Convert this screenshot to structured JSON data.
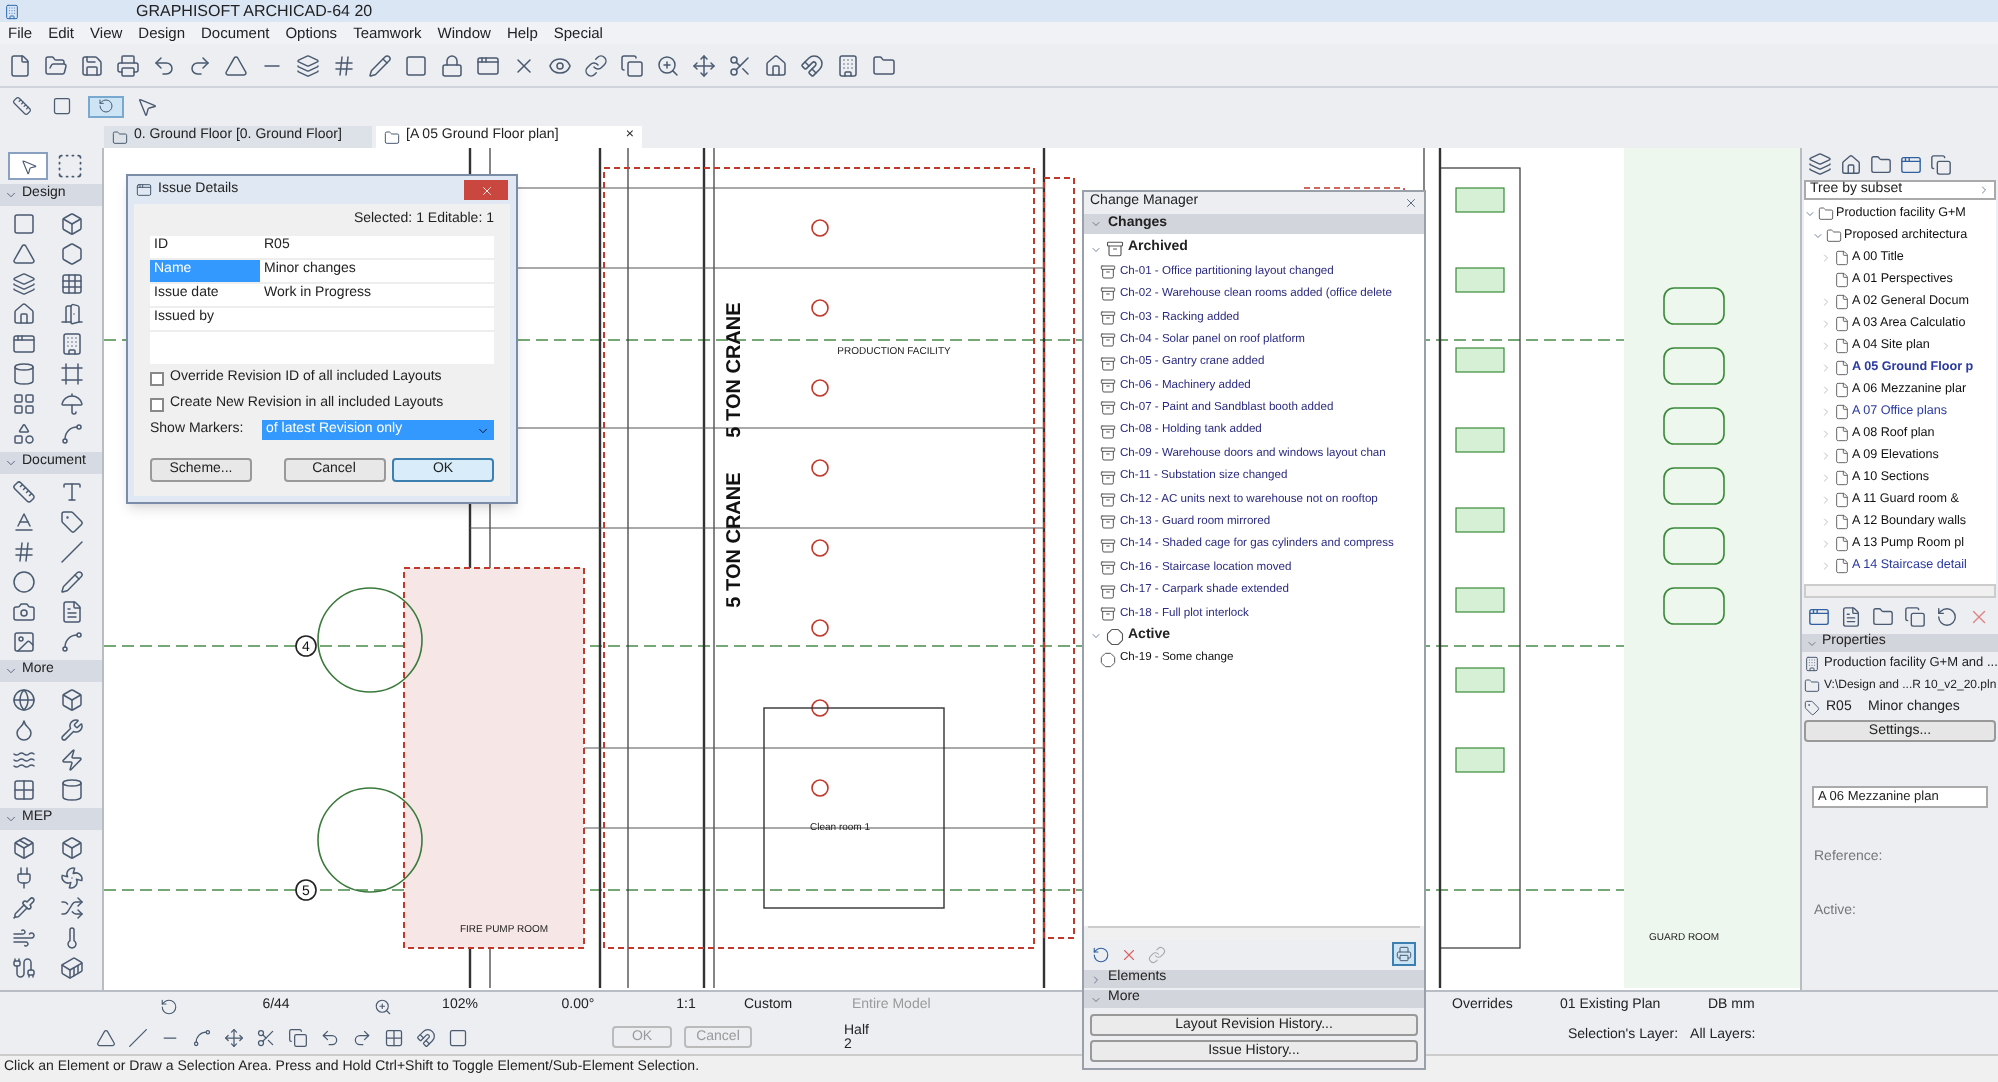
{
  "window": {
    "title": "GRAPHISOFT ARCHICAD-64 20"
  },
  "menu": [
    "File",
    "Edit",
    "View",
    "Design",
    "Document",
    "Options",
    "Teamwork",
    "Window",
    "Help",
    "Special"
  ],
  "tabs": [
    {
      "label": "0. Ground Floor [0. Ground Floor]",
      "selected": false
    },
    {
      "label": "[A 05 Ground Floor plan]",
      "selected": true
    }
  ],
  "tab_close": "×",
  "toolbox": {
    "sections": [
      {
        "label": "Design",
        "expanded": true
      },
      {
        "label": "Document",
        "expanded": true
      },
      {
        "label": "More",
        "expanded": true
      },
      {
        "label": "MEP",
        "expanded": true
      }
    ]
  },
  "plan": {
    "crane_labels": [
      "5 TON CRANE",
      "5 TON CRANE"
    ],
    "room_labels": [
      "PRODUCTION FACILITY",
      "Clean room 1",
      "FIRE PUMP ROOM",
      "GUARD ROOM"
    ],
    "grid_markers": [
      "4",
      "5"
    ]
  },
  "issue_dialog": {
    "title": "Issue Details",
    "selection": "Selected: 1 Editable: 1",
    "rows": [
      {
        "label": "ID",
        "value": "R05",
        "selected": false
      },
      {
        "label": "Name",
        "value": "Minor changes",
        "selected": true
      },
      {
        "label": "Issue date",
        "value": "Work in Progress",
        "selected": false
      },
      {
        "label": "Issued by",
        "selected": false
      }
    ],
    "checkboxes": [
      {
        "label": "Override Revision ID of all included Layouts",
        "checked": false
      },
      {
        "label": "Create New Revision in all included Layouts",
        "checked": false
      }
    ],
    "markers": {
      "label": "Show Markers:",
      "value": "of latest Revision only"
    },
    "buttons": [
      {
        "label": "Scheme...",
        "default": false
      },
      {
        "label": "Cancel",
        "default": false
      },
      {
        "label": "OK",
        "default": true
      }
    ]
  },
  "change_manager": {
    "title": "Change Manager",
    "changes": {
      "label": "Changes",
      "expanded": true,
      "groups": [
        {
          "label": "Archived",
          "kind": "archived",
          "expanded": true,
          "children": [
            {
              "label": "Ch-01 - Office partitioning layout changed"
            },
            {
              "label": "Ch-02 - Warehouse clean rooms added (office delete"
            },
            {
              "label": "Ch-03 - Racking added"
            },
            {
              "label": "Ch-04 - Solar panel on roof platform"
            },
            {
              "label": "Ch-05 - Gantry crane added"
            },
            {
              "label": "Ch-06 - Machinery added"
            },
            {
              "label": "Ch-07 - Paint and Sandblast booth added"
            },
            {
              "label": "Ch-08 - Holding tank added"
            },
            {
              "label": "Ch-09 - Warehouse doors and windows layout chan"
            },
            {
              "label": "Ch-11 - Substation size changed"
            },
            {
              "label": "Ch-12 - AC units next to warehouse not on rooftop"
            },
            {
              "label": "Ch-13 - Guard room mirrored"
            },
            {
              "label": "Ch-14 - Shaded cage for gas cylinders and compress"
            },
            {
              "label": "Ch-16 - Staircase location moved"
            },
            {
              "label": "Ch-17 - Carpark shade extended"
            },
            {
              "label": "Ch-18 - Full plot interlock"
            }
          ]
        },
        {
          "label": "Active",
          "kind": "active",
          "expanded": true,
          "children": [
            {
              "label": "Ch-19 - Some change"
            }
          ]
        }
      ]
    },
    "sections": [
      {
        "label": "Elements",
        "expanded": false
      },
      {
        "label": "More",
        "expanded": true
      }
    ],
    "buttons": [
      "Layout Revision History...",
      "Issue History..."
    ]
  },
  "navigator": {
    "view": "Tree by subset",
    "tree": [
      {
        "label": "Production facility G+M",
        "expanded": true,
        "children": [
          {
            "label": "Proposed architectura",
            "expanded": true,
            "children": [
              {
                "label": "A 00 Title",
                "expandable": true,
                "highlighted": false,
                "selected": false
              },
              {
                "label": "A 01 Perspectives",
                "expandable": false,
                "highlighted": false,
                "selected": false
              },
              {
                "label": "A 02 General Docum",
                "expandable": true,
                "highlighted": false,
                "selected": false
              },
              {
                "label": "A 03 Area Calculatio",
                "expandable": true,
                "highlighted": false,
                "selected": false
              },
              {
                "label": "A 04 Site plan",
                "expandable": true,
                "highlighted": false,
                "selected": false
              },
              {
                "label": "A 05 Ground Floor p",
                "expandable": true,
                "highlighted": true,
                "selected": true
              },
              {
                "label": "A 06 Mezzanine plar",
                "expandable": true,
                "highlighted": false,
                "selected": false
              },
              {
                "label": "A 07 Office plans",
                "expandable": true,
                "highlighted": true,
                "selected": false
              },
              {
                "label": "A 08 Roof plan",
                "expandable": true,
                "highlighted": false,
                "selected": false
              },
              {
                "label": "A 09 Elevations",
                "expandable": true,
                "highlighted": false,
                "selected": false
              },
              {
                "label": "A 10 Sections",
                "expandable": true,
                "highlighted": false,
                "selected": false
              },
              {
                "label": "A 11 Guard room &",
                "expandable": true,
                "highlighted": false,
                "selected": false
              },
              {
                "label": "A 12 Boundary walls",
                "expandable": true,
                "highlighted": false,
                "selected": false
              },
              {
                "label": "A 13 Pump Room pl",
                "expandable": true,
                "highlighted": false,
                "selected": false
              },
              {
                "label": "A 14 Staircase detail",
                "expandable": true,
                "highlighted": true,
                "selected": false
              }
            ]
          }
        ]
      }
    ]
  },
  "properties": {
    "label": "Properties",
    "expanded": true,
    "project": "Production facility G+M and ...",
    "file": "V:\\Design and ...R 10_v2_20.pln",
    "id": "R05",
    "name": "Minor changes",
    "button": "Settings..."
  },
  "preview": {
    "layout": "A 06 Mezzanine plan",
    "reference": "Reference:",
    "active": "Active:"
  },
  "bottom_bar": {
    "page": "6/44",
    "zoom": "102%",
    "angle": "0.00°",
    "scale": "1:1",
    "layer_combo": "Custom",
    "model": "Entire Model",
    "overrides": "Overrides",
    "plan": "01 Existing Plan",
    "dimension": "DB mm",
    "ok": {
      "label": "OK",
      "disabled": true
    },
    "cancel": {
      "label": "Cancel",
      "disabled": true
    },
    "pen": "Half",
    "pen_number": "2",
    "selection_layer": "Selection's Layer:",
    "all_layers": "All Layers:"
  },
  "status_bar": "Click an Element or Draw a Selection Area. Press and Hold Ctrl+Shift to Toggle Element/Sub-Element Selection."
}
